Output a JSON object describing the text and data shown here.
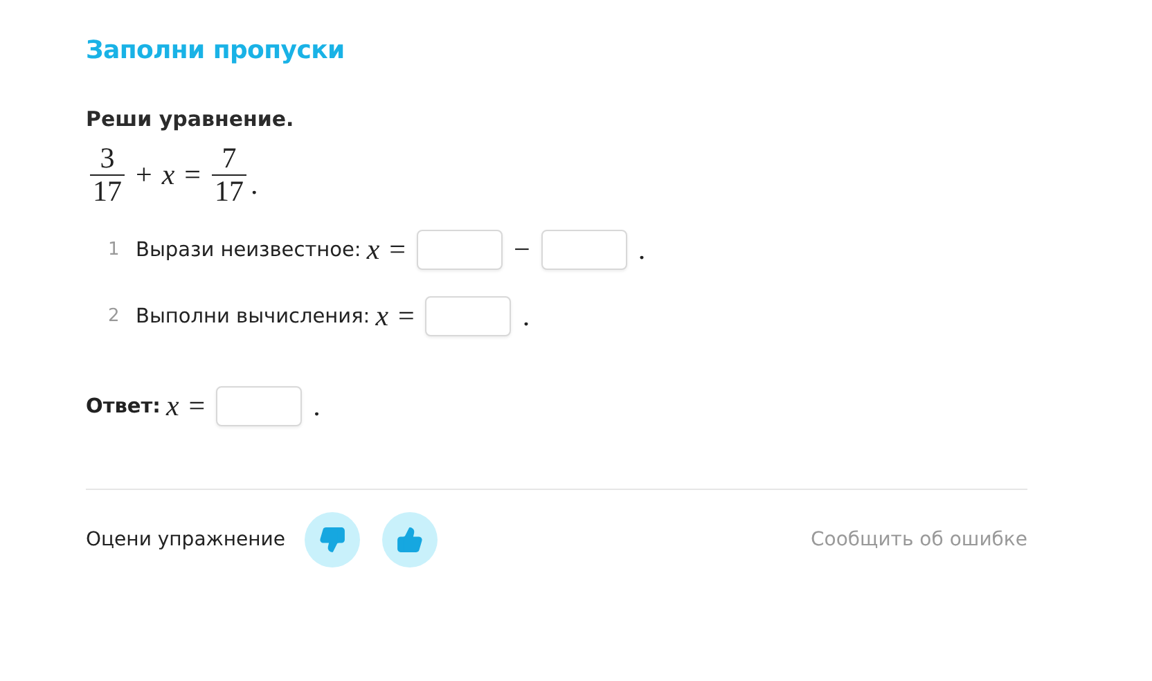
{
  "title": "Заполни пропуски",
  "task": "Реши уравнение.",
  "equation": {
    "left": {
      "num": "3",
      "den": "17"
    },
    "plus": "+",
    "var": "x",
    "eq": "=",
    "right": {
      "num": "7",
      "den": "17"
    },
    "end": "."
  },
  "steps": [
    {
      "number": "1",
      "label": "Вырази неизвестное:",
      "var": "x",
      "eq": "=",
      "parts": [
        {
          "kind": "field"
        },
        {
          "kind": "sign",
          "text": "−"
        },
        {
          "kind": "field"
        },
        {
          "kind": "sign",
          "text": "."
        }
      ]
    },
    {
      "number": "2",
      "label": "Выполни вычисления:",
      "var": "x",
      "eq": "=",
      "parts": [
        {
          "kind": "field"
        },
        {
          "kind": "sign",
          "text": "."
        }
      ]
    }
  ],
  "answer": {
    "label": "Ответ:",
    "var": "x",
    "eq": "=",
    "parts": [
      {
        "kind": "field"
      },
      {
        "kind": "sign",
        "text": "."
      }
    ]
  },
  "footer": {
    "rate_label": "Оцени упражнение",
    "report_link": "Сообщить об ошибке"
  }
}
